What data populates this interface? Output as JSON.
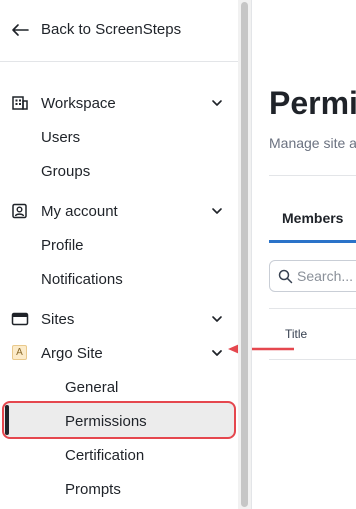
{
  "sidebar": {
    "back": {
      "label": "Back to ScreenSteps",
      "icon": "arrow-left-icon"
    },
    "workspace": {
      "label": "Workspace",
      "icon": "building-icon",
      "items": [
        "Users",
        "Groups"
      ]
    },
    "my_account": {
      "label": "My account",
      "icon": "user-card-icon",
      "items": [
        "Profile",
        "Notifications"
      ]
    },
    "sites": {
      "label": "Sites",
      "icon": "browser-window-icon"
    },
    "site": {
      "badge": "A",
      "label": "Argo Site",
      "items": [
        "General",
        "Permissions",
        "Certification",
        "Prompts"
      ],
      "active_item": "Permissions"
    }
  },
  "main": {
    "title": "Permis",
    "subtitle": "Manage site a",
    "tabs": [
      {
        "label": "Members",
        "active": true
      }
    ],
    "search": {
      "placeholder": "Search..."
    },
    "table": {
      "columns": [
        "Title"
      ]
    }
  },
  "colors": {
    "accent": "#2a73c9",
    "highlight_border": "#e5474e",
    "annotation_arrow": "#e5474e",
    "active_background": "#ececec"
  }
}
